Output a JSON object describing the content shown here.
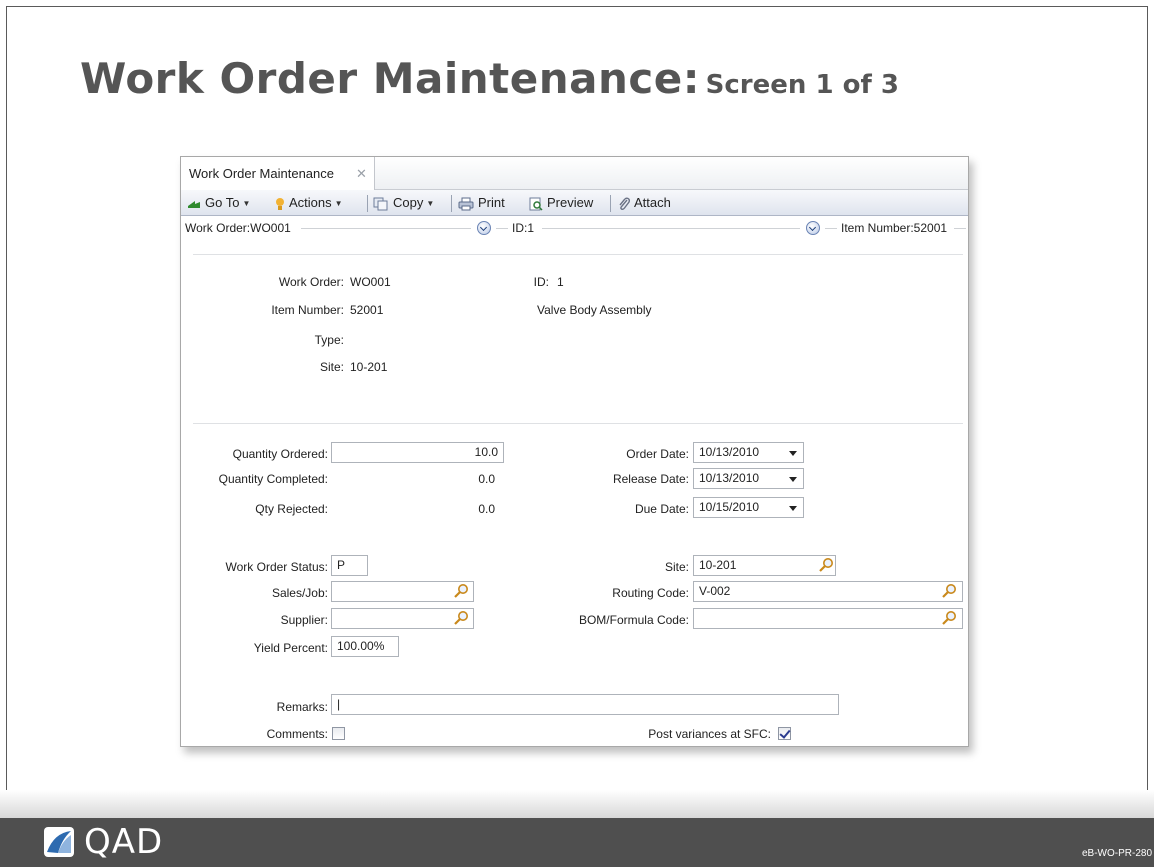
{
  "slide": {
    "title": "Work Order Maintenance:",
    "subtitle": "Screen 1 of 3",
    "code": "eB-WO-PR-280",
    "logo_text": "QAD"
  },
  "window": {
    "tab_label": "Work Order Maintenance",
    "tab_close": "✕",
    "toolbar": {
      "goto": "Go To",
      "actions": "Actions",
      "copy": "Copy",
      "print": "Print",
      "preview": "Preview",
      "attach": "Attach"
    },
    "crumbs": {
      "work_order": "Work Order:WO001",
      "id": "ID:1",
      "item_number": "Item Number:52001"
    }
  },
  "header": {
    "work_order_label": "Work Order:",
    "work_order_value": "WO001",
    "id_label": "ID:",
    "id_value": "1",
    "item_number_label": "Item Number:",
    "item_number_value": "52001",
    "item_description": "Valve Body Assembly",
    "type_label": "Type:",
    "site_label": "Site:",
    "site_value": "10-201"
  },
  "quantities": {
    "ordered_label": "Quantity Ordered:",
    "ordered_value": "10.0",
    "completed_label": "Quantity Completed:",
    "completed_value": "0.0",
    "rejected_label": "Qty Rejected:",
    "rejected_value": "0.0"
  },
  "dates": {
    "order_label": "Order Date:",
    "order_value": "10/13/2010",
    "release_label": "Release Date:",
    "release_value": "10/13/2010",
    "due_label": "Due Date:",
    "due_value": "10/15/2010"
  },
  "details": {
    "status_label": "Work Order Status:",
    "status_value": "P",
    "sales_job_label": "Sales/Job:",
    "sales_job_value": "",
    "supplier_label": "Supplier:",
    "supplier_value": "",
    "yield_label": "Yield Percent:",
    "yield_value": "100.00%",
    "site_label": "Site:",
    "site_value": "10-201",
    "routing_label": "Routing Code:",
    "routing_value": "V-002",
    "bom_label": "BOM/Formula Code:",
    "bom_value": ""
  },
  "footer_fields": {
    "remarks_label": "Remarks:",
    "remarks_value": "|",
    "comments_label": "Comments:",
    "comments_checked": false,
    "post_variances_label": "Post variances at SFC:",
    "post_variances_checked": true
  },
  "colors": {
    "footer_bar": "#4f4f4f",
    "title_gray": "#555555",
    "toolbar_border": "#aeb6c6"
  }
}
